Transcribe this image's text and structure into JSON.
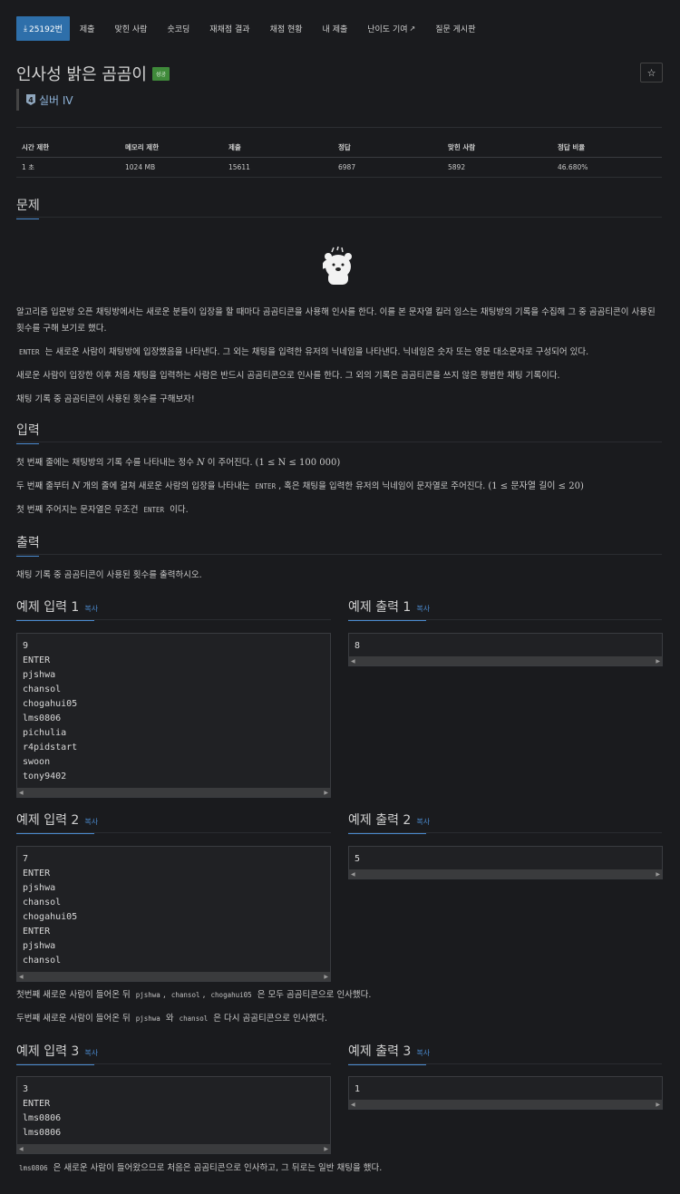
{
  "nav": {
    "problem_id": "25192번",
    "items": [
      "제출",
      "맞힌 사람",
      "숏코딩",
      "재채점 결과",
      "채점 현황",
      "내 제출",
      "난이도 기여",
      "질문 게시판"
    ]
  },
  "problem": {
    "title": "인사성 밝은 곰곰이",
    "status_badge": "성공",
    "tier": "실버 IV",
    "tier_number": "4"
  },
  "stats": {
    "headers": [
      "시간 제한",
      "메모리 제한",
      "제출",
      "정답",
      "맞힌 사람",
      "정답 비율"
    ],
    "values": [
      "1 초",
      "1024 MB",
      "15611",
      "6987",
      "5892",
      "46.680%"
    ]
  },
  "sections": {
    "problem": "문제",
    "input": "입력",
    "output": "출력",
    "copy_label": "복사"
  },
  "problem_text": {
    "p1": "알고리즘 입문방 오픈 채팅방에서는 새로운 분들이 입장을 할 때마다 곰곰티콘을 사용해 인사를 한다. 이를 본 문자열 킬러 임스는 채팅방의 기록을 수집해 그 중 곰곰티콘이 사용된 횟수를 구해 보기로 했다.",
    "p2_code": "ENTER",
    "p2_text": "는 새로운 사람이 채팅방에 입장했음을 나타낸다. 그 외는 채팅을 입력한 유저의 닉네임을 나타낸다. 닉네임은 숫자 또는 영문 대소문자로 구성되어 있다.",
    "p3": "새로운 사람이 입장한 이후 처음 채팅을 입력하는 사람은 반드시 곰곰티콘으로 인사를 한다. 그 외의 기록은 곰곰티콘을 쓰지 않은 평범한 채팅 기록이다.",
    "p4": "채팅 기록 중 곰곰티콘이 사용된 횟수를 구해보자!"
  },
  "input_text": {
    "l1_a": "첫 번째 줄에는 채팅방의 기록 수를 나타내는 정수",
    "l1_var": "N",
    "l1_b": "이 주어진다.",
    "l1_math": "(1 ≤ N ≤ 100 000)",
    "l2_a": "두 번째 줄부터",
    "l2_var": "N",
    "l2_b": "개의 줄에 걸쳐 새로운 사람의 입장을 나타내는",
    "l2_code": "ENTER",
    "l2_c": ", 혹은 채팅을 입력한 유저의 닉네임이 문자열로 주어진다.",
    "l2_math": "(1 ≤ 문자열 길이 ≤ 20)",
    "l3_a": "첫 번째 주어지는 문자열은 무조건",
    "l3_code": "ENTER",
    "l3_b": "이다."
  },
  "output_text": "채팅 기록 중 곰곰티콘이 사용된 횟수를 출력하시오.",
  "examples": [
    {
      "input_title": "예제 입력 1",
      "output_title": "예제 출력 1",
      "input": "9\nENTER\npjshwa\nchansol\nchogahui05\nlms0806\npichulia\nr4pidstart\nswoon\ntony9402",
      "output": "8"
    },
    {
      "input_title": "예제 입력 2",
      "output_title": "예제 출력 2",
      "input": "7\nENTER\npjshwa\nchansol\nchogahui05\nENTER\npjshwa\nchansol",
      "output": "5"
    },
    {
      "input_title": "예제 입력 3",
      "output_title": "예제 출력 3",
      "input": "3\nENTER\nlms0806\nlms0806",
      "output": "1"
    }
  ],
  "hints": {
    "h2a_pre": "첫번째 새로운 사람이 들어온 뒤",
    "h2a_c1": "pjshwa",
    "h2a_c2": "chansol",
    "h2a_c3": "chogahui05",
    "h2a_post": "은 모두 곰곰티콘으로 인사했다.",
    "h2b_pre": "두번째 새로운 사람이 들어온 뒤",
    "h2b_c1": "pjshwa",
    "h2b_mid": "와",
    "h2b_c2": "chansol",
    "h2b_post": "은 다시 곰곰티콘으로 인사했다.",
    "h3_code": "lms0806",
    "h3_text": "은 새로운 사람이 들어왔으므로 처음은 곰곰티콘으로 인사하고, 그 뒤로는 일반 채팅을 했다."
  }
}
